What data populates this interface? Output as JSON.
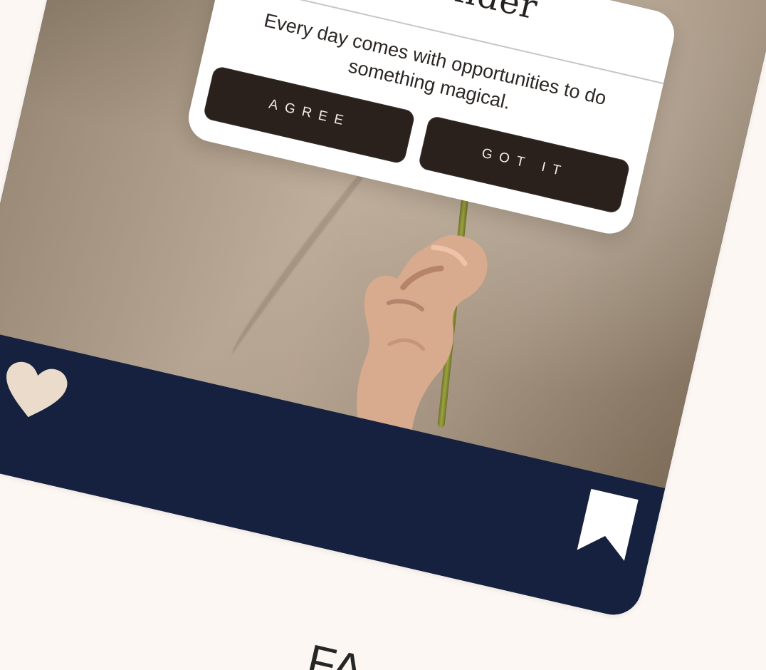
{
  "post": {
    "popup": {
      "title": "Reminder",
      "message": "Every day comes with opportunities to do something magical.",
      "buttons": [
        {
          "label": "AGREE"
        },
        {
          "label": "GOT IT"
        }
      ]
    },
    "actions": {
      "like_icon": "heart-icon",
      "save_icon": "bookmark-icon"
    },
    "caption_fragment": "FA"
  },
  "colors": {
    "page_background": "#fcf7f3",
    "card_background": "#15213f",
    "button_background": "#2a211d",
    "heart_fill": "#eadbcb",
    "bookmark_fill": "#ffffff"
  }
}
